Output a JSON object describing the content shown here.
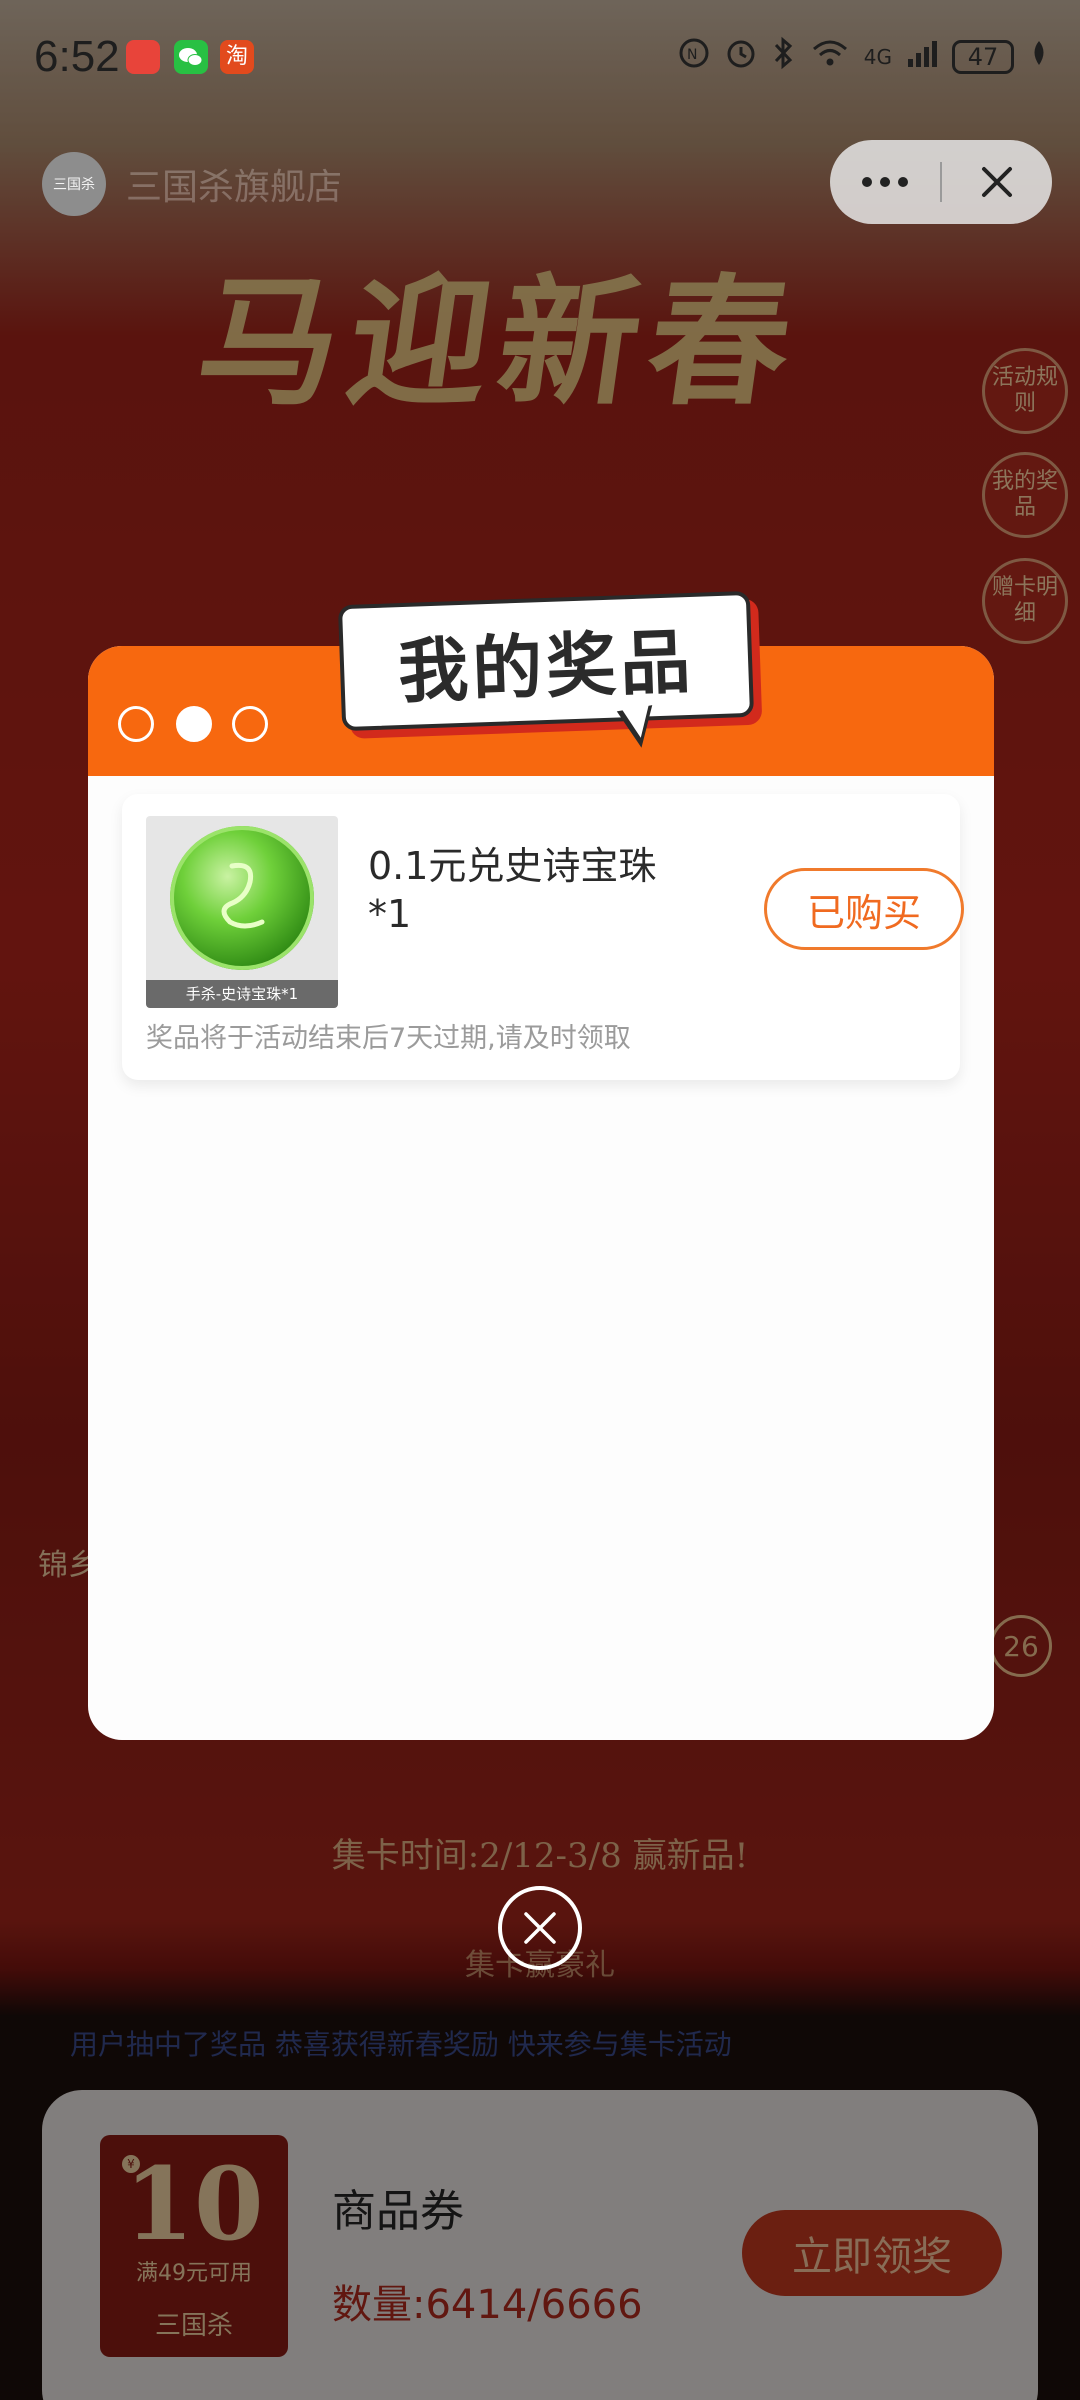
{
  "status_bar": {
    "time": "6:52",
    "signal": "4G",
    "battery": "47"
  },
  "mp_header": {
    "title": "三国杀旗舰店",
    "more_icon": "more-dots-icon",
    "close_icon": "close-icon"
  },
  "background": {
    "banner_title": "马迎新春",
    "side_buttons": [
      "活动规则",
      "我的奖品",
      "赠卡明细"
    ],
    "left_label": "锦乡",
    "count_badge": "26",
    "collect_time": "集卡时间:2/12-3/8 赢新品!",
    "collect_sub": "集卡赢豪礼",
    "marquee": "用户抽中了奖品  恭喜获得新春奖励  快来参与集卡活动"
  },
  "modal": {
    "title": "我的奖品",
    "accent_color": "#f7680f",
    "prizes": [
      {
        "name": "0.1元兑史诗宝珠*1",
        "image_caption": "手杀-史诗宝珠*1",
        "button_label": "已购买",
        "note": "奖品将于活动结束后7天过期,请及时领取"
      }
    ]
  },
  "reward_card": {
    "coupon_value": "10",
    "coupon_condition": "满49元可用",
    "coupon_brand": "三国杀",
    "name": "商品券",
    "quantity": "数量:6414/6666",
    "button_label": "立即领奖"
  }
}
